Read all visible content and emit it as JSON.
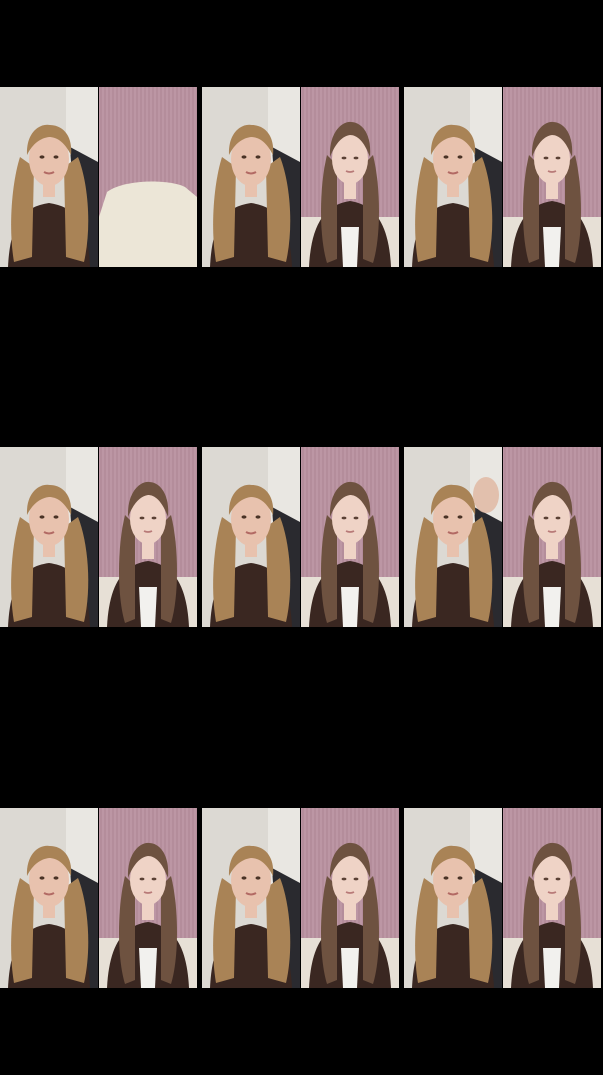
{
  "layout": {
    "rows": 3,
    "columns": 3
  },
  "colors": {
    "background": "#000000",
    "room_wall": "#dcd9d3",
    "pink_curtain": "#b48d9b",
    "blonde_hair": "#a98356",
    "brown_hair": "#6e5240",
    "skin": "#e8c2ae",
    "dark_top": "#3a2721",
    "white_shirt": "#f2f1ee",
    "chair": "#2a2a2f",
    "blanket": "#ece6d7"
  },
  "frames": [
    {
      "left_scene": "blonde-woman-room",
      "right_scene": "pink-room-empty"
    },
    {
      "left_scene": "blonde-woman-room",
      "right_scene": "brunette-woman-pink"
    },
    {
      "left_scene": "blonde-woman-room",
      "right_scene": "brunette-woman-pink"
    },
    {
      "left_scene": "blonde-woman-room",
      "right_scene": "brunette-woman-pink"
    },
    {
      "left_scene": "blonde-woman-room",
      "right_scene": "brunette-woman-pink"
    },
    {
      "left_scene": "blonde-woman-room-waving",
      "right_scene": "brunette-woman-pink"
    },
    {
      "left_scene": "blonde-woman-room",
      "right_scene": "brunette-woman-pink"
    },
    {
      "left_scene": "blonde-woman-room",
      "right_scene": "brunette-woman-pink"
    },
    {
      "left_scene": "blonde-woman-room",
      "right_scene": "brunette-woman-pink"
    }
  ]
}
